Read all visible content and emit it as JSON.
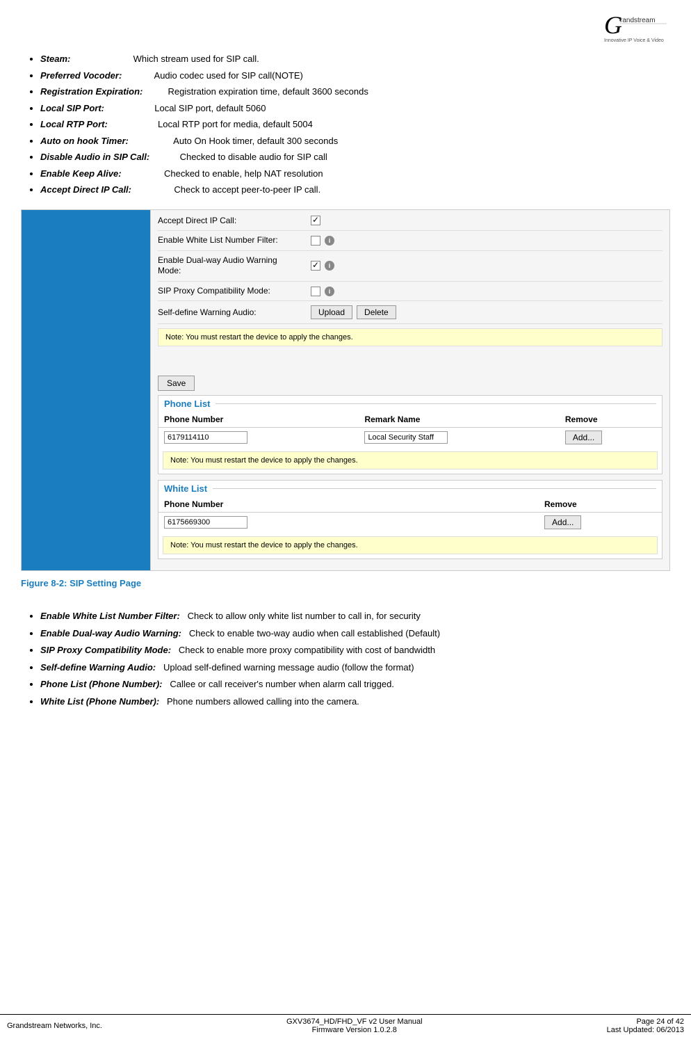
{
  "logo": {
    "alt": "Grandstream Logo",
    "tagline": "Innovative IP Voice & Video"
  },
  "bullets_top": [
    {
      "term": "Steam:",
      "desc": "Which stream used for SIP call."
    },
    {
      "term": "Preferred Vocoder:",
      "desc": "Audio codec used for SIP call(NOTE)"
    },
    {
      "term": "Registration Expiration:",
      "desc": "Registration expiration time, default 3600 seconds"
    },
    {
      "term": "Local SIP Port:",
      "desc": "Local SIP port, default 5060"
    },
    {
      "term": "Local RTP Port:",
      "desc": "Local RTP port for media, default 5004"
    },
    {
      "term": "Auto on hook Timer:",
      "desc": "Auto On Hook timer, default 300 seconds"
    },
    {
      "term": "Disable Audio in SIP Call:",
      "desc": "Checked to disable audio for SIP call"
    },
    {
      "term": "Enable Keep Alive:",
      "desc": "Checked to enable, help NAT resolution"
    },
    {
      "term": "Accept Direct IP Call:",
      "desc": "Check to accept peer-to-peer IP call."
    }
  ],
  "screenshot": {
    "form_rows": [
      {
        "label": "Accept Direct IP Call:",
        "type": "checkbox",
        "checked": true,
        "has_info": false
      },
      {
        "label": "Enable White List Number Filter:",
        "type": "checkbox",
        "checked": false,
        "has_info": true
      },
      {
        "label": "Enable Dual-way Audio Warning Mode:",
        "type": "checkbox",
        "checked": true,
        "has_info": true
      },
      {
        "label": "SIP Proxy Compatibility Mode:",
        "type": "checkbox",
        "checked": false,
        "has_info": true
      },
      {
        "label": "Self-define Warning Audio:",
        "type": "buttons",
        "buttons": [
          "Upload",
          "Delete"
        ]
      }
    ],
    "note1": "Note: You must restart the device to apply the changes.",
    "save_label": "Save",
    "phone_list": {
      "title": "Phone List",
      "columns": [
        "Phone Number",
        "Remark Name",
        "Remove"
      ],
      "rows": [
        {
          "phone": "6179114110",
          "remark": "Local Security Staff",
          "action": "Add..."
        }
      ],
      "note": "Note: You must restart the device to apply the changes."
    },
    "white_list": {
      "title": "White List",
      "columns": [
        "Phone Number",
        "",
        "Remove"
      ],
      "rows": [
        {
          "phone": "6175669300",
          "remark": "",
          "action": "Add..."
        }
      ],
      "note": "Note: You must restart the device to apply the changes."
    }
  },
  "figure_caption": "Figure 8-2:  SIP Setting Page",
  "bullets_bottom": [
    {
      "term": "Enable White List Number Filter:",
      "desc": "Check to allow only white list number to call in, for security"
    },
    {
      "term": "Enable Dual-way Audio Warning:",
      "desc": "Check to enable two-way audio when call established (Default)"
    },
    {
      "term": "SIP Proxy Compatibility Mode:",
      "desc": "Check to enable more proxy compatibility with cost of bandwidth"
    },
    {
      "term": "Self-define Warning Audio:",
      "desc": "Upload self-defined warning message audio (follow the format)"
    },
    {
      "term": "Phone List (Phone Number):",
      "desc": "Callee or call receiver's number when alarm call trigged."
    },
    {
      "term": "White List (Phone Number):",
      "desc": "Phone numbers allowed calling into the camera."
    }
  ],
  "footer": {
    "left": "Grandstream Networks, Inc.",
    "center_line1": "GXV3674_HD/FHD_VF v2 User Manual",
    "center_line2": "Firmware Version 1.0.2.8",
    "right_line1": "Page 24 of 42",
    "right_line2": "Last Updated: 06/2013"
  }
}
